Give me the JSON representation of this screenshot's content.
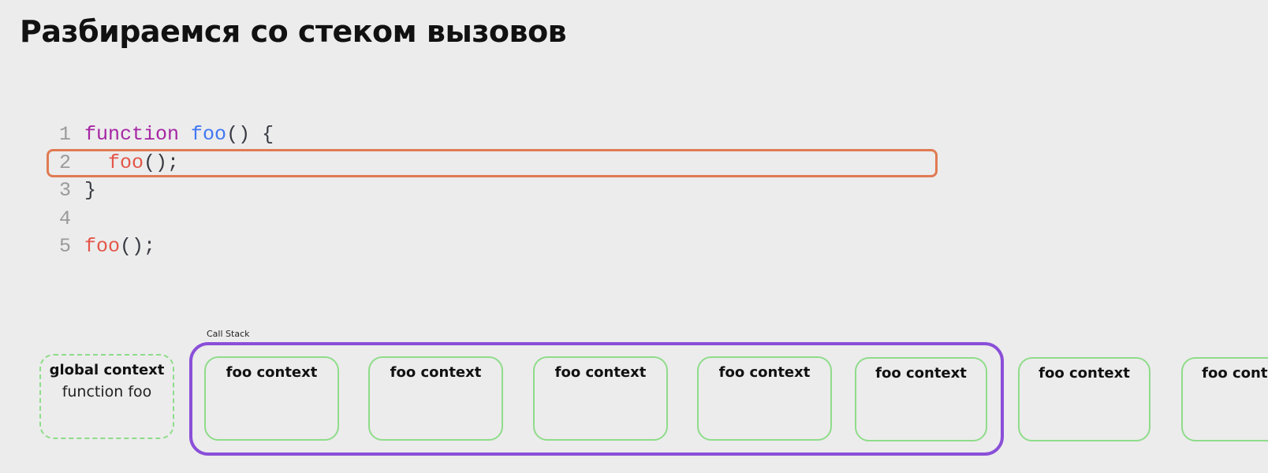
{
  "title": "Разбираемся со стеком вызовов",
  "code": {
    "line_numbers": [
      "1",
      "2",
      "3",
      "4",
      "5"
    ],
    "line1": {
      "keyword": "function",
      "space": " ",
      "name": "foo",
      "rest": "() {"
    },
    "line2": {
      "indent": "  ",
      "call": "foo",
      "rest": "();"
    },
    "line3": {
      "text": "}"
    },
    "line5": {
      "call": "foo",
      "rest": "();"
    }
  },
  "global_context": {
    "title": "global context",
    "subtitle": "function foo"
  },
  "call_stack": {
    "label": "Call Stack",
    "frames": [
      "foo context",
      "foo context",
      "foo context",
      "foo context",
      "foo context"
    ]
  },
  "overflow_frames": [
    "foo context",
    "foo context"
  ],
  "colors": {
    "highlight_border": "#e07b53",
    "call_stack_border": "#8a4fd8",
    "context_border": "#8fdc8a",
    "keyword": "#a626a4",
    "function_name": "#4078f2",
    "function_call": "#e45649"
  }
}
